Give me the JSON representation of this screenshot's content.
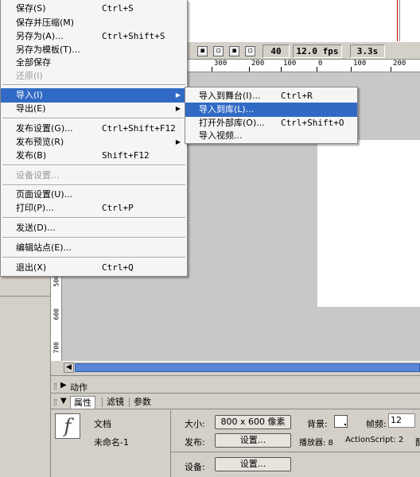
{
  "file_menu": {
    "items": [
      {
        "label": "保存(S)",
        "shortcut": "Ctrl+S"
      },
      {
        "label": "保存并压缩(M)",
        "shortcut": ""
      },
      {
        "label": "另存为(A)...",
        "shortcut": "Ctrl+Shift+S"
      },
      {
        "label": "另存为模板(T)...",
        "shortcut": ""
      },
      {
        "label": "全部保存",
        "shortcut": ""
      },
      {
        "label": "还原(I)",
        "shortcut": "",
        "disabled": true
      },
      {
        "label": "导入(I)",
        "shortcut": "",
        "selected": true
      },
      {
        "label": "导出(E)",
        "shortcut": ""
      },
      {
        "label": "发布设置(G)...",
        "shortcut": "Ctrl+Shift+F12"
      },
      {
        "label": "发布预览(R)",
        "shortcut": ""
      },
      {
        "label": "发布(B)",
        "shortcut": "Shift+F12"
      },
      {
        "label": "设备设置...",
        "shortcut": "",
        "disabled": true
      },
      {
        "label": "页面设置(U)...",
        "shortcut": ""
      },
      {
        "label": "打印(P)...",
        "shortcut": "Ctrl+P"
      },
      {
        "label": "发送(D)...",
        "shortcut": ""
      },
      {
        "label": "编辑站点(E)...",
        "shortcut": ""
      },
      {
        "label": "退出(X)",
        "shortcut": "Ctrl+Q"
      }
    ]
  },
  "import_submenu": {
    "items": [
      {
        "label": "导入到舞台(I)...",
        "shortcut": "Ctrl+R"
      },
      {
        "label": "导入到库(L)...",
        "shortcut": "",
        "selected": true
      },
      {
        "label": "打开外部库(O)...",
        "shortcut": "Ctrl+Shift+O"
      },
      {
        "label": "导入视频...",
        "shortcut": ""
      }
    ]
  },
  "timeline": {
    "frame": "40",
    "fps": "12.0 fps",
    "time": "3.3s",
    "ruler_h": [
      "300",
      "200",
      "100",
      "0",
      "100",
      "200"
    ],
    "ruler_v": [
      "500",
      "600",
      "700"
    ]
  },
  "panels": {
    "actions_label": "动作",
    "tabs": [
      "属性",
      "滤镜",
      "参数"
    ],
    "doc_icon_glyph": "f",
    "doc_type": "文档",
    "doc_name": "未命名-1",
    "size_label": "大小:",
    "size_value": "800 x 600 像素",
    "bg_label": "背景:",
    "fps_label": "帧频:",
    "fps_value": "12",
    "publish_label": "发布:",
    "settings_btn": "设置...",
    "player_label": "播放器: 8",
    "as_label": "ActionScript: 2",
    "truncated_label": "配",
    "device_label": "设备:",
    "device_btn": "设置..."
  },
  "colors": {
    "menu_highlight": "#316ac5",
    "stage_bg": "#c8c8c8",
    "panel_bg": "#d4d0c8"
  }
}
